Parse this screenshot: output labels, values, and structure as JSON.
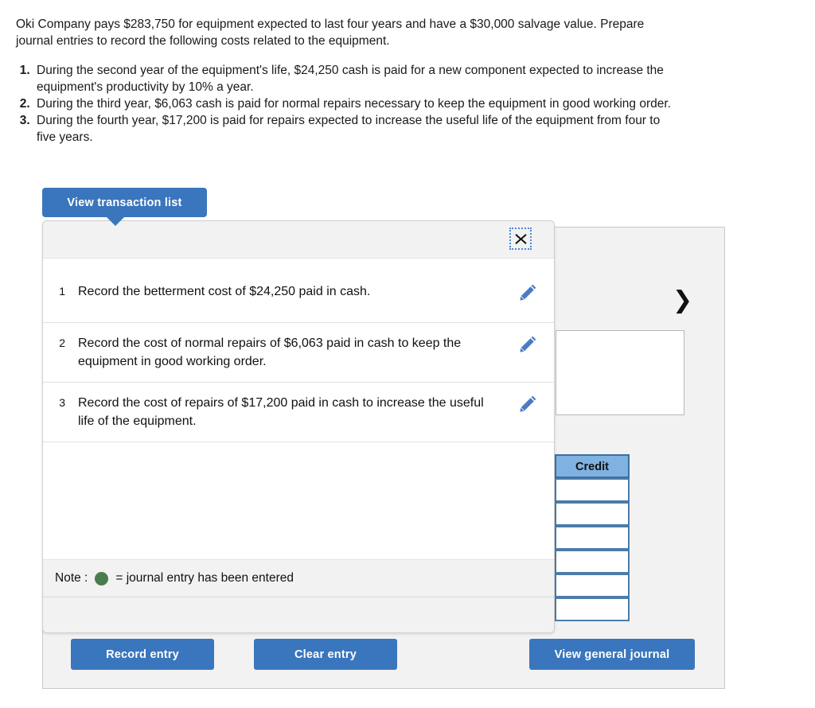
{
  "problem": {
    "intro": "Oki Company pays $283,750 for equipment expected to last four years and have a $30,000 salvage value. Prepare journal entries to record the following costs related to the equipment.",
    "items": [
      "During the second year of the equipment's life, $24,250 cash is paid for a new component expected to increase the equipment's productivity by 10% a year.",
      "During the third year, $6,063 cash is paid for normal repairs necessary to keep the equipment in good working order.",
      "During the fourth year, $17,200 is paid for repairs expected to increase the useful life of the equipment from four to five years."
    ]
  },
  "toolbar": {
    "view_transaction_list_label": "View transaction list"
  },
  "popover": {
    "close_icon": "close-icon",
    "transactions": [
      {
        "num": "1",
        "text": "Record the betterment cost of $24,250 paid in cash.",
        "edit_icon": "pencil-icon"
      },
      {
        "num": "2",
        "text": "Record the cost of normal repairs of $6,063 paid in cash to keep the equipment in good working order.",
        "edit_icon": "pencil-icon"
      },
      {
        "num": "3",
        "text": "Record the cost of repairs of $17,200 paid in cash to increase the useful life of the equipment.",
        "edit_icon": "pencil-icon"
      }
    ],
    "note_prefix": "Note :",
    "note_suffix": "= journal entry has been entered",
    "note_dot_color": "#4a7c4e"
  },
  "journal": {
    "credit_header": "Credit",
    "credit_rows": [
      "",
      "",
      "",
      "",
      "",
      ""
    ],
    "next_icon": "chevron-right-icon",
    "memo_value": ""
  },
  "actions": {
    "record_entry_label": "Record entry",
    "clear_entry_label": "Clear entry",
    "view_general_journal_label": "View general journal"
  },
  "colors": {
    "button_blue": "#3a76bd",
    "header_blue": "#7fb2e0",
    "cell_border_blue": "#4b7cab",
    "panel_grey": "#f2f2f2"
  }
}
